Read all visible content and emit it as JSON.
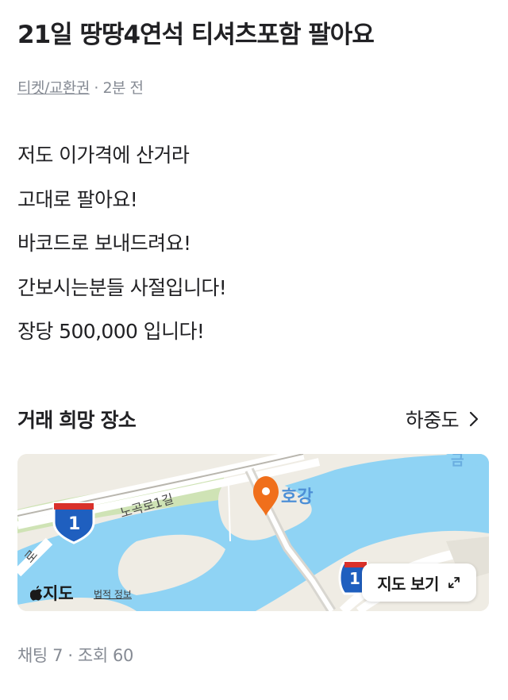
{
  "post": {
    "title": "21일 땅땅4연석 티셔츠포함 팔아요",
    "category": "티켓/교환권",
    "time_ago": "· 2분 전",
    "body_lines": [
      "저도 이가격에 산거라",
      "고대로 팔아요!",
      "바코드로 보내드려요!",
      "간보시는분들 사절입니다!",
      "장당 500,000 입니다!"
    ]
  },
  "place": {
    "heading": "거래 희망 장소",
    "location_name": "하중도"
  },
  "map": {
    "road_label": "노곡로1길",
    "road_label_left": "로",
    "water_label": "호강",
    "water_label_corner": "금",
    "route_shield": "1",
    "route_shield_right": "1",
    "provider": "지도",
    "legal_link": "법적 정보",
    "view_map_button": "지도 보기",
    "colors": {
      "water": "#8fd3f4",
      "land": "#efece4",
      "park": "#cfe3b5",
      "pin": "#f06f1b",
      "road": "#ffffff"
    }
  },
  "stats": {
    "text": "채팅 7 · 조회 60"
  }
}
